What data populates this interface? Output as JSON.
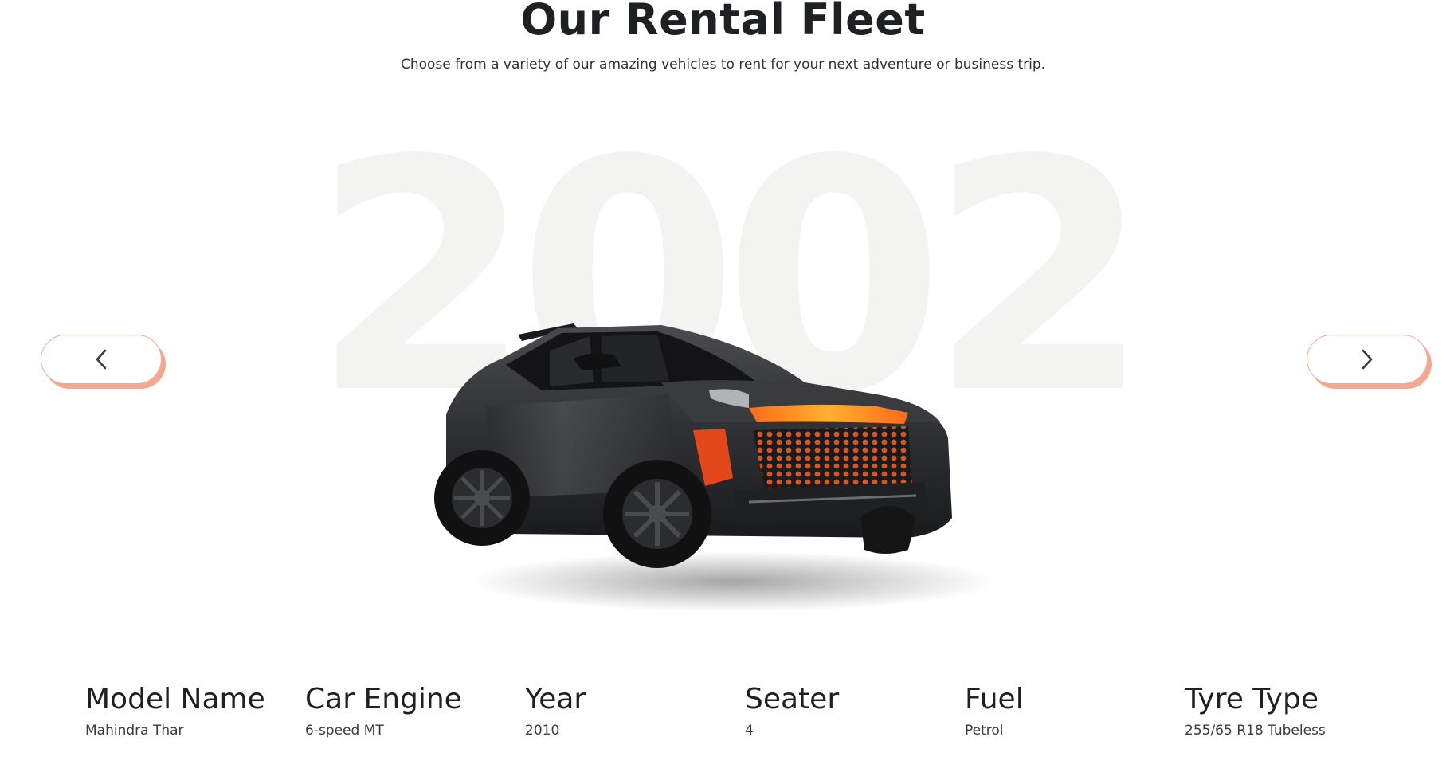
{
  "section": {
    "title": "Our Rental Fleet",
    "subtitle": "Choose from a variety of our amazing vehicles to rent for your next adventure or business trip."
  },
  "carousel": {
    "background_year": "2002",
    "prev_icon": "chevron-left-icon",
    "next_icon": "chevron-right-icon",
    "accent_color": "#f3a891"
  },
  "car": {
    "image_label": "Black SUV with orange accents"
  },
  "specs": [
    {
      "label": "Model Name",
      "value": "Mahindra Thar"
    },
    {
      "label": "Car Engine",
      "value": "6-speed MT"
    },
    {
      "label": "Year",
      "value": "2010"
    },
    {
      "label": "Seater",
      "value": "4"
    },
    {
      "label": "Fuel",
      "value": "Petrol"
    },
    {
      "label": "Tyre Type",
      "value": "255/65 R18 Tubeless"
    }
  ]
}
